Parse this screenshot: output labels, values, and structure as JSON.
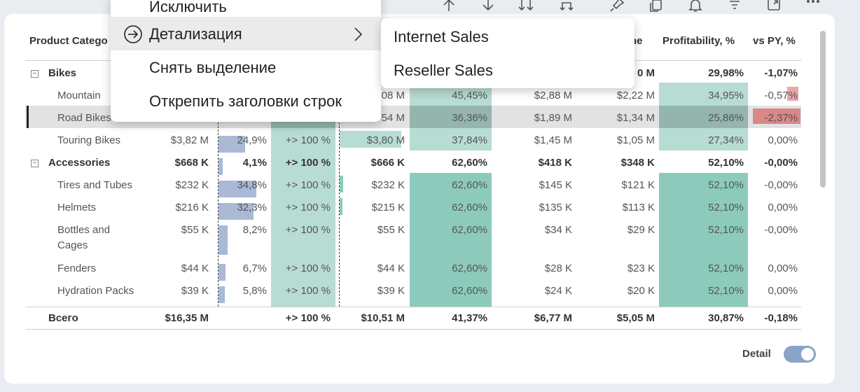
{
  "colors": {
    "teal_light": "#b7dcd3",
    "teal": "#8ccbbc",
    "teal_dark": "#78bfae",
    "teal_darker": "#93b5ad",
    "bar": "#a9b9d6",
    "red": "#d98787",
    "red_light": "#e8a8a8",
    "toggle": "#8aa3c9"
  },
  "toolbar": {
    "icons": [
      "arrow-up-icon",
      "arrow-down-icon",
      "double-arrow-down-icon",
      "fork-icon",
      "pin-icon",
      "copy-icon",
      "bell-icon",
      "filter-icon",
      "expand-icon",
      "more-icon"
    ]
  },
  "headers": {
    "product_category": "Product Catego",
    "col8": "ne",
    "profitability": "Profitability, %",
    "vs_py": "vs PY, %"
  },
  "rows": [
    {
      "level": 0,
      "label": "Bikes",
      "expander": "−",
      "bold": true,
      "c1": "",
      "c2": "",
      "c3": "",
      "c4": "",
      "c5": "",
      "c6": "",
      "c7": "0 M",
      "c8": "29,98%",
      "c9": "-1,07%"
    },
    {
      "level": 1,
      "label": "Mountain",
      "bold": false,
      "c1": "",
      "c2": "",
      "c3": "",
      "c4": "08 M",
      "c5": "45,45%",
      "c6": "$2,88 M",
      "c7": "$2,22 M",
      "c8": "34,95%",
      "c9": "-0,57%"
    },
    {
      "level": 1,
      "label": "Road Bikes",
      "bold": false,
      "c1": "",
      "c2": "",
      "c3": "",
      "c4": "54 M",
      "c5": "36,36%",
      "c6": "$1,89 M",
      "c7": "$1,34 M",
      "c8": "25,86%",
      "c9": "-2,37%"
    },
    {
      "level": 1,
      "label": "Touring Bikes",
      "bold": false,
      "c1": "$3,82 M",
      "c2": "24,9%",
      "c3": "+> 100 %",
      "c4": "$3,80 M",
      "c5": "37,84%",
      "c6": "$1,45 M",
      "c7": "$1,05 M",
      "c8": "27,34%",
      "c9": "0,00%"
    },
    {
      "level": 0,
      "label": "Accessories",
      "expander": "−",
      "bold": true,
      "c1": "$668 K",
      "c2": "4,1%",
      "c3": "+> 100 %",
      "c4": "$666 K",
      "c5": "62,60%",
      "c6": "$418 K",
      "c7": "$348 K",
      "c8": "52,10%",
      "c9": "-0,00%"
    },
    {
      "level": 1,
      "label": "Tires and Tubes",
      "bold": false,
      "c1": "$232 K",
      "c2": "34,8%",
      "c3": "+> 100 %",
      "c4": "$232 K",
      "c5": "62,60%",
      "c6": "$145 K",
      "c7": "$121 K",
      "c8": "52,10%",
      "c9": "-0,00%"
    },
    {
      "level": 1,
      "label": "Helmets",
      "bold": false,
      "c1": "$216 K",
      "c2": "32,3%",
      "c3": "+> 100 %",
      "c4": "$215 K",
      "c5": "62,60%",
      "c6": "$135 K",
      "c7": "$113 K",
      "c8": "52,10%",
      "c9": "0,00%"
    },
    {
      "level": 1,
      "label": "Bottles and",
      "label2": "Cages",
      "bold": false,
      "c1": "$55 K",
      "c2": "8,2%",
      "c3": "+> 100 %",
      "c4": "$55 K",
      "c5": "62,60%",
      "c6": "$34 K",
      "c7": "$29 K",
      "c8": "52,10%",
      "c9": "-0,00%"
    },
    {
      "level": 1,
      "label": "Fenders",
      "bold": false,
      "c1": "$44 K",
      "c2": "6,7%",
      "c3": "+> 100 %",
      "c4": "$44 K",
      "c5": "62,60%",
      "c6": "$28 K",
      "c7": "$23 K",
      "c8": "52,10%",
      "c9": "0,00%"
    },
    {
      "level": 1,
      "label": "Hydration Packs",
      "bold": false,
      "c1": "$39 K",
      "c2": "5,8%",
      "c3": "+> 100 %",
      "c4": "$39 K",
      "c5": "62,60%",
      "c6": "$24 K",
      "c7": "$20 K",
      "c8": "52,10%",
      "c9": "0,00%"
    }
  ],
  "total": {
    "label": "Всего",
    "c1": "$16,35 M",
    "c2": "",
    "c3": "+> 100 %",
    "c4": "$10,51 M",
    "c5": "41,37%",
    "c6": "$6,77 M",
    "c7": "$5,05 M",
    "c8": "30,87%",
    "c9": "-0,18%"
  },
  "bar_values": {
    "share_pct": [
      0,
      0,
      0,
      24.9,
      4.1,
      34.8,
      32.3,
      8.2,
      6.7,
      5.8
    ]
  },
  "context_menu": {
    "items": [
      "Исключить",
      "Детализация",
      "Снять выделение",
      "Открепить заголовки строк"
    ]
  },
  "sub_menu": {
    "items": [
      "Internet Sales",
      "Reseller Sales"
    ]
  },
  "toggle": {
    "label": "Detail",
    "on": true
  }
}
